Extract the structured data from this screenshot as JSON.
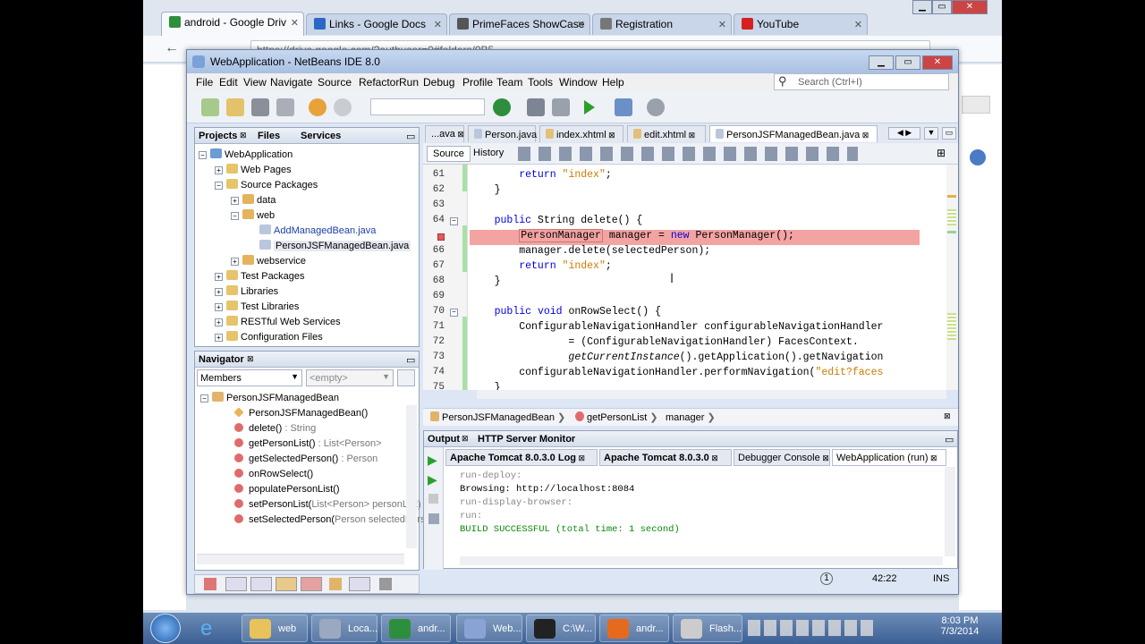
{
  "browser": {
    "tabs": [
      {
        "title": "android - Google Driv",
        "color": "#2d8f3c"
      },
      {
        "title": "Links - Google Docs",
        "color": "#2b67c6"
      },
      {
        "title": "PrimeFaces ShowCase",
        "color": "#555555"
      },
      {
        "title": "Registration",
        "color": "#777777"
      },
      {
        "title": "YouTube",
        "color": "#d61f1f"
      }
    ],
    "addressbar": "https://drive.google.com/?authuser=0#folders/0B5..."
  },
  "netbeans": {
    "title": "WebApplication - NetBeans IDE 8.0",
    "menu": [
      "File",
      "Edit",
      "View",
      "Navigate",
      "Source",
      "Refactor",
      "Run",
      "Debug",
      "Profile",
      "Team",
      "Tools",
      "Window",
      "Help"
    ],
    "search_placeholder": "Search (Ctrl+I)",
    "projects": {
      "tabs": [
        "Projects",
        "Files",
        "Services"
      ],
      "tree": [
        {
          "label": "WebApplication",
          "depth": 0,
          "exp": "−",
          "icon": "globe"
        },
        {
          "label": "Web Pages",
          "depth": 1,
          "exp": "+",
          "icon": "folder"
        },
        {
          "label": "Source Packages",
          "depth": 1,
          "exp": "−",
          "icon": "folder"
        },
        {
          "label": "data",
          "depth": 2,
          "exp": "+",
          "icon": "package"
        },
        {
          "label": "web",
          "depth": 2,
          "exp": "−",
          "icon": "package"
        },
        {
          "label": "AddManagedBean.java",
          "depth": 3,
          "exp": "",
          "icon": "java",
          "link": true
        },
        {
          "label": "PersonJSFManagedBean.java",
          "depth": 3,
          "exp": "",
          "icon": "java",
          "selected": true
        },
        {
          "label": "webservice",
          "depth": 2,
          "exp": "+",
          "icon": "package"
        },
        {
          "label": "Test Packages",
          "depth": 1,
          "exp": "+",
          "icon": "folder"
        },
        {
          "label": "Libraries",
          "depth": 1,
          "exp": "+",
          "icon": "folder"
        },
        {
          "label": "Test Libraries",
          "depth": 1,
          "exp": "+",
          "icon": "folder"
        },
        {
          "label": "RESTful Web Services",
          "depth": 1,
          "exp": "+",
          "icon": "folder"
        },
        {
          "label": "Configuration Files",
          "depth": 1,
          "exp": "+",
          "icon": "folder"
        }
      ]
    },
    "navigator": {
      "title": "Navigator",
      "filter": "Members",
      "empty": "<empty>",
      "root": "PersonJSFManagedBean",
      "items": [
        {
          "name": "PersonJSFManagedBean()",
          "type": "",
          "kind": "ctor"
        },
        {
          "name": "delete()",
          "type": " : String",
          "kind": "method"
        },
        {
          "name": "getPersonList()",
          "type": " : List<Person>",
          "kind": "method"
        },
        {
          "name": "getSelectedPerson()",
          "type": " : Person",
          "kind": "method"
        },
        {
          "name": "onRowSelect()",
          "type": "",
          "kind": "method"
        },
        {
          "name": "populatePersonList()",
          "type": "",
          "kind": "method"
        },
        {
          "name": "setPersonList(",
          "type": "List<Person> personList)",
          "kind": "method"
        },
        {
          "name": "setSelectedPerson(",
          "type": "Person selectedPers",
          "kind": "method"
        }
      ]
    },
    "editor": {
      "tabs": [
        "...ava",
        "Person.java",
        "index.xhtml",
        "edit.xhtml",
        "PersonJSFManagedBean.java"
      ],
      "source_tab": "Source",
      "history_tab": "History",
      "lines": [
        {
          "n": "61",
          "code": "        return \"index\";"
        },
        {
          "n": "62",
          "code": "    }"
        },
        {
          "n": "63",
          "code": ""
        },
        {
          "n": "64",
          "code": "    public String delete() {"
        },
        {
          "n": "",
          "code": "        PersonManager manager = new PersonManager();"
        },
        {
          "n": "66",
          "code": "        manager.delete(selectedPerson);"
        },
        {
          "n": "67",
          "code": "        return \"index\";"
        },
        {
          "n": "68",
          "code": "    }"
        },
        {
          "n": "69",
          "code": ""
        },
        {
          "n": "70",
          "code": "    public void onRowSelect() {"
        },
        {
          "n": "71",
          "code": "        ConfigurableNavigationHandler configurableNavigationHandler"
        },
        {
          "n": "72",
          "code": "                = (ConfigurableNavigationHandler) FacesContext."
        },
        {
          "n": "73",
          "code": "                getCurrentInstance().getApplication().getNavigation"
        },
        {
          "n": "74",
          "code": "        configurableNavigationHandler.performNavigation(\"edit?faces"
        },
        {
          "n": "75",
          "code": "    }"
        }
      ],
      "breadcrumb": [
        "PersonJSFManagedBean",
        "getPersonList",
        "manager"
      ]
    },
    "output": {
      "tabs": [
        "Output",
        "HTTP Server Monitor"
      ],
      "subtabs": [
        "Apache Tomcat 8.0.3.0 Log",
        "Apache Tomcat 8.0.3.0",
        "Debugger Console",
        "WebApplication (run)"
      ],
      "lines": [
        {
          "text": "run-deploy:",
          "cls": "gray"
        },
        {
          "text": "Browsing: http://localhost:8084",
          "cls": ""
        },
        {
          "text": "run-display-browser:",
          "cls": "gray"
        },
        {
          "text": "run:",
          "cls": "gray"
        },
        {
          "text": "BUILD SUCCESSFUL (total time: 1 second)",
          "cls": "green"
        }
      ]
    },
    "status": {
      "notifications": "1",
      "position": "42:22",
      "mode": "INS"
    }
  },
  "taskbar": {
    "items": [
      {
        "label": "web",
        "color": "#e8c25a"
      },
      {
        "label": "Loca...",
        "color": "#9aa9c0"
      },
      {
        "label": "andr...",
        "color": "#2d8f3c"
      },
      {
        "label": "Web...",
        "color": "#8aa3d6"
      },
      {
        "label": "C:\\W...",
        "color": "#222222"
      },
      {
        "label": "andr...",
        "color": "#e66a1e"
      },
      {
        "label": "Flash...",
        "color": "#cccccc"
      }
    ],
    "time": "8:03 PM",
    "date": "7/3/2014"
  }
}
